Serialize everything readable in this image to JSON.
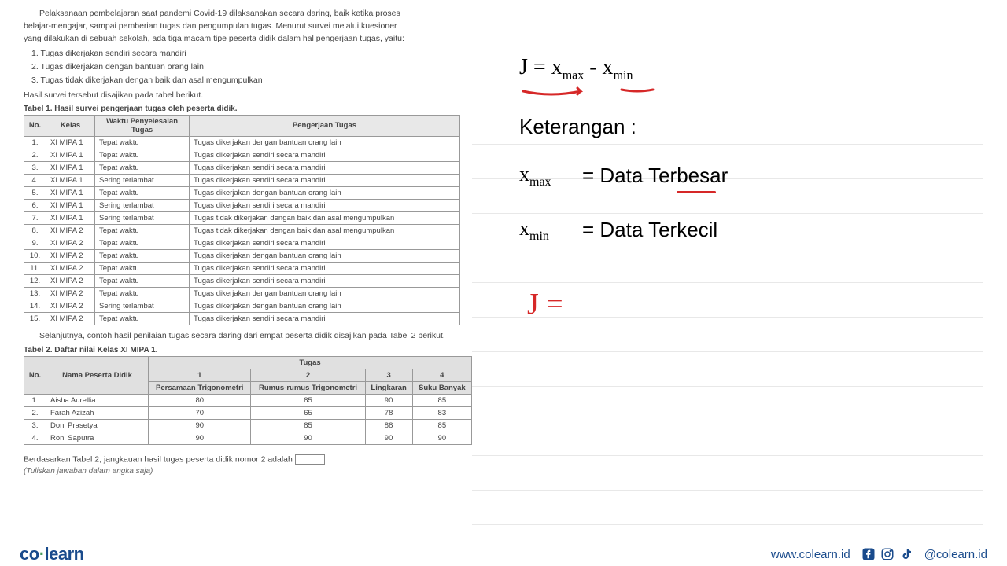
{
  "intro": {
    "line1": "Pelaksanaan pembelajaran saat pandemi Covid-19 dilaksanakan secara daring, baik ketika proses",
    "line2": "belajar-mengajar, sampai pemberian tugas dan pengumpulan tugas. Menurut survei melalui kuesioner",
    "line3": "yang dilakukan di sebuah sekolah, ada tiga macam tipe peserta didik dalam hal pengerjaan tugas, yaitu:"
  },
  "list": {
    "i1": "1.   Tugas dikerjakan sendiri secara mandiri",
    "i2": "2.   Tugas dikerjakan dengan bantuan orang lain",
    "i3": "3.   Tugas tidak dikerjakan dengan baik dan asal mengumpulkan"
  },
  "hasil": "Hasil survei tersebut disajikan pada tabel berikut.",
  "tabel1_caption": "Tabel 1. Hasil survei pengerjaan tugas oleh peserta didik.",
  "t1": {
    "h1": "No.",
    "h2": "Kelas",
    "h3": "Waktu Penyelesaian Tugas",
    "h4": "Pengerjaan Tugas",
    "rows": [
      {
        "no": "1.",
        "kelas": "XI MIPA 1",
        "waktu": "Tepat waktu",
        "peng": "Tugas dikerjakan dengan bantuan orang lain"
      },
      {
        "no": "2.",
        "kelas": "XI MIPA 1",
        "waktu": "Tepat waktu",
        "peng": "Tugas dikerjakan sendiri secara mandiri"
      },
      {
        "no": "3.",
        "kelas": "XI MIPA 1",
        "waktu": "Tepat waktu",
        "peng": "Tugas dikerjakan sendiri secara mandiri"
      },
      {
        "no": "4.",
        "kelas": "XI MIPA 1",
        "waktu": "Sering terlambat",
        "peng": "Tugas dikerjakan sendiri secara mandiri"
      },
      {
        "no": "5.",
        "kelas": "XI MIPA 1",
        "waktu": "Tepat waktu",
        "peng": "Tugas dikerjakan dengan bantuan orang lain"
      },
      {
        "no": "6.",
        "kelas": "XI MIPA 1",
        "waktu": "Sering terlambat",
        "peng": "Tugas dikerjakan sendiri secara mandiri"
      },
      {
        "no": "7.",
        "kelas": "XI MIPA 1",
        "waktu": "Sering terlambat",
        "peng": "Tugas tidak dikerjakan dengan baik dan asal mengumpulkan"
      },
      {
        "no": "8.",
        "kelas": "XI MIPA 2",
        "waktu": "Tepat waktu",
        "peng": "Tugas tidak dikerjakan dengan baik dan asal mengumpulkan"
      },
      {
        "no": "9.",
        "kelas": "XI MIPA 2",
        "waktu": "Tepat waktu",
        "peng": "Tugas dikerjakan sendiri secara mandiri"
      },
      {
        "no": "10.",
        "kelas": "XI MIPA 2",
        "waktu": "Tepat waktu",
        "peng": "Tugas dikerjakan dengan bantuan orang lain"
      },
      {
        "no": "11.",
        "kelas": "XI MIPA 2",
        "waktu": "Tepat waktu",
        "peng": "Tugas dikerjakan sendiri secara mandiri"
      },
      {
        "no": "12.",
        "kelas": "XI MIPA 2",
        "waktu": "Tepat waktu",
        "peng": "Tugas dikerjakan sendiri secara mandiri"
      },
      {
        "no": "13.",
        "kelas": "XI MIPA 2",
        "waktu": "Tepat waktu",
        "peng": "Tugas dikerjakan dengan bantuan orang lain"
      },
      {
        "no": "14.",
        "kelas": "XI MIPA 2",
        "waktu": "Sering terlambat",
        "peng": "Tugas dikerjakan dengan bantuan orang lain"
      },
      {
        "no": "15.",
        "kelas": "XI MIPA 2",
        "waktu": "Tepat waktu",
        "peng": "Tugas dikerjakan sendiri secara mandiri"
      }
    ]
  },
  "afternote": "Selanjutnya, contoh hasil penilaian tugas secara daring dari empat peserta didik disajikan pada Tabel 2 berikut.",
  "tabel2_caption": "Tabel 2. Daftar nilai Kelas XI MIPA 1.",
  "t2": {
    "h_no": "No.",
    "h_nama": "Nama Peserta Didik",
    "h_tugas": "Tugas",
    "c1": "1",
    "c2": "2",
    "c3": "3",
    "c4": "4",
    "s1": "Persamaan Trigonometri",
    "s2": "Rumus-rumus Trigonometri",
    "s3": "Lingkaran",
    "s4": "Suku Banyak",
    "rows": [
      {
        "no": "1.",
        "nama": "Aisha Aurellia",
        "v1": "80",
        "v2": "85",
        "v3": "90",
        "v4": "85"
      },
      {
        "no": "2.",
        "nama": "Farah Azizah",
        "v1": "70",
        "v2": "65",
        "v3": "78",
        "v4": "83"
      },
      {
        "no": "3.",
        "nama": "Doni Prasetya",
        "v1": "90",
        "v2": "85",
        "v3": "88",
        "v4": "85"
      },
      {
        "no": "4.",
        "nama": "Roni Saputra",
        "v1": "90",
        "v2": "90",
        "v3": "90",
        "v4": "90"
      }
    ]
  },
  "question": "Berdasarkan Tabel 2, jangkauan hasil tugas peserta didik nomor 2 adalah ",
  "instruct": "(Tuliskan jawaban dalam angka saja)",
  "formula": {
    "j": "J = x",
    "max": "max",
    "minus": " - x",
    "min": "min"
  },
  "keterangan": "Keterangan :",
  "xmax": {
    "sym": "x",
    "sub": "max",
    "label": "= Data Terbesar"
  },
  "xmin": {
    "sym": "x",
    "sub": "min",
    "label": "= Data Terkecil"
  },
  "handj": "J  =",
  "footer": {
    "logo_co": "co",
    "logo_learn": "learn",
    "url": "www.colearn.id",
    "handle": "@colearn.id"
  },
  "chart_data": {
    "type": "table",
    "title": "Daftar nilai Kelas XI MIPA 1",
    "columns": [
      "Persamaan Trigonometri",
      "Rumus-rumus Trigonometri",
      "Lingkaran",
      "Suku Banyak"
    ],
    "rows": [
      {
        "name": "Aisha Aurellia",
        "values": [
          80,
          85,
          90,
          85
        ]
      },
      {
        "name": "Farah Azizah",
        "values": [
          70,
          65,
          78,
          83
        ]
      },
      {
        "name": "Doni Prasetya",
        "values": [
          90,
          85,
          88,
          85
        ]
      },
      {
        "name": "Roni Saputra",
        "values": [
          90,
          90,
          90,
          90
        ]
      }
    ]
  }
}
